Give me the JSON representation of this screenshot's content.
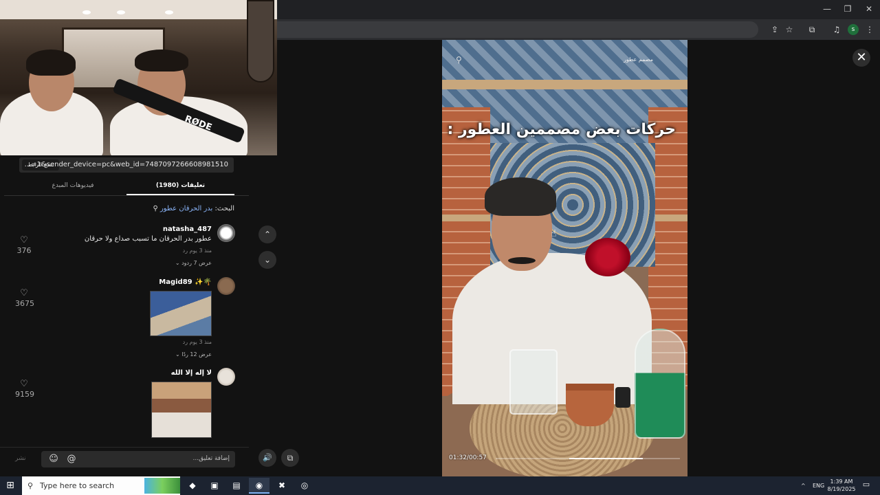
{
  "window": {
    "minimize": "—",
    "restore": "❐",
    "close": "✕"
  },
  "toolbar": {
    "install_icon": "⇪",
    "star_icon": "☆",
    "extensions_icon": "⧉",
    "media_icon": "♫",
    "profile_letter": "s",
    "menu_icon": "⋮"
  },
  "link": {
    "copy_label": "نسخ الرابط",
    "url_text": "...=1&sender_device=pc&web_id=7487097266608981510"
  },
  "tabs": [
    {
      "label": "تعليقات (1980)"
    },
    {
      "label": "فيديوهات المبدع"
    }
  ],
  "search": {
    "prefix": "البحث: ",
    "term": "بدر الحرقان عطور",
    "icon": "⚲"
  },
  "comments": [
    {
      "user": "natasha_487",
      "text": "عطور بدر الحرقان ما تسبب صداع ولا حرقان",
      "meta": "منذ 3 يوم     رد",
      "replies": "عرض 7 ردود ⌄",
      "likes": "376"
    },
    {
      "user": "Magid89 ✨🌴",
      "text": "",
      "meta": "منذ 3 يوم     رد",
      "replies": "عرض 12 ردًا ⌄",
      "likes": "3675"
    },
    {
      "user": "لا إله إلا الله",
      "text": "",
      "meta": "",
      "replies": "",
      "likes": "9159"
    }
  ],
  "comment_input": {
    "placeholder": "إضافة تعليق...",
    "post_label": "نشر",
    "emoji_icon": "☺",
    "mention_icon": "@"
  },
  "nav": {
    "up_icon": "⌃",
    "down_icon": "⌄",
    "volume_icon": "🔊",
    "pip_icon": "⧉"
  },
  "video": {
    "overlay_title": "حركات بعض مصممين العطور :",
    "search_icon": "⚲",
    "top_right_text": "مصمم عطور",
    "time": "01:32/00:57",
    "progress": 0.4
  },
  "close_icon": "✕",
  "taskbar": {
    "start_icon": "⊞",
    "search_placeholder": "Type here to search",
    "search_icon": "⚲",
    "apps": [
      "◆",
      "▣",
      "▤",
      "◉",
      "✖",
      "◎"
    ],
    "tray_chevron": "^",
    "lang": "ENG",
    "time": "1:39 AM",
    "date": "8/19/2025",
    "notif_icon": "▭"
  }
}
